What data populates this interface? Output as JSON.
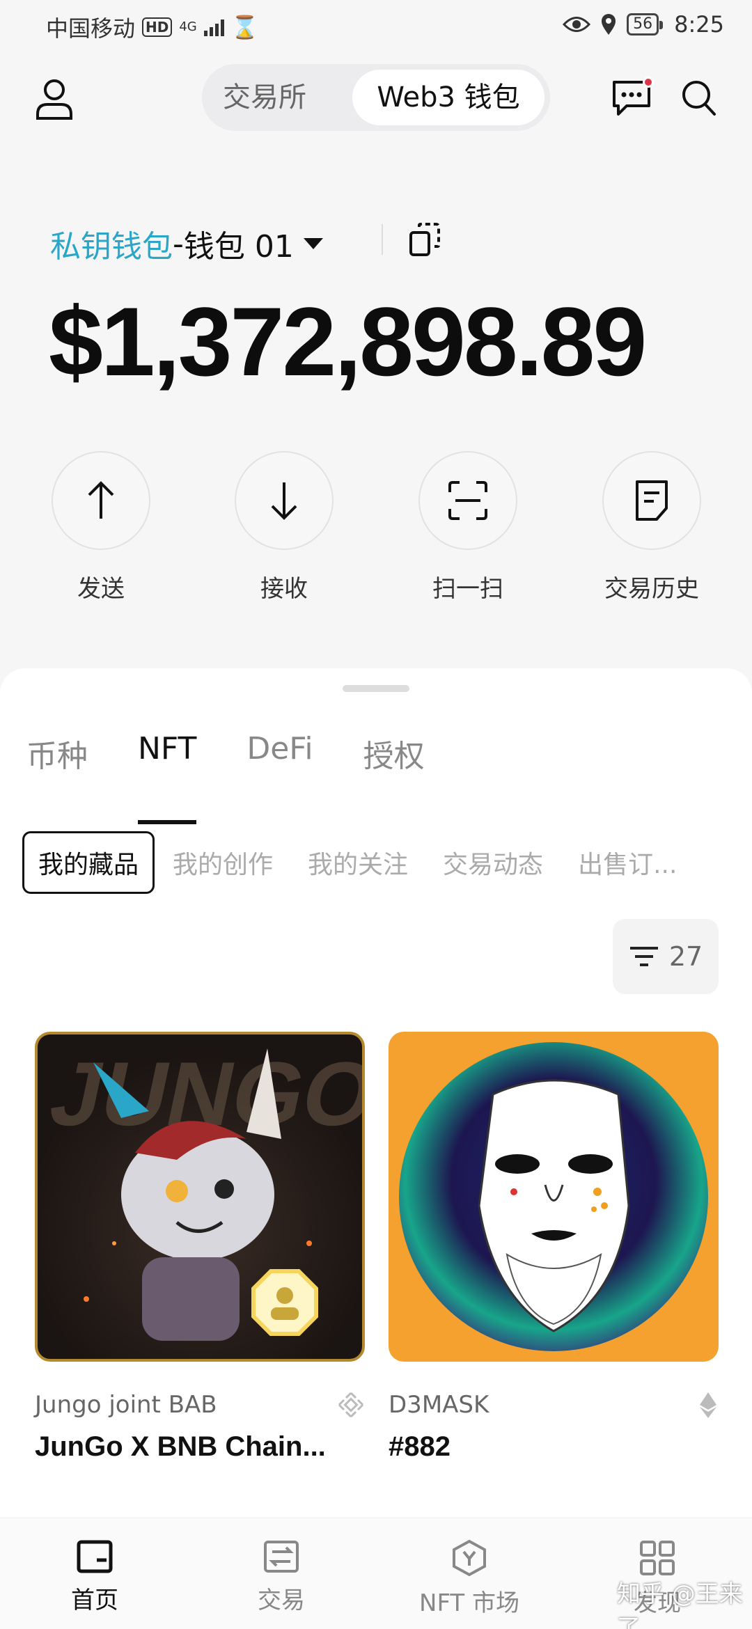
{
  "status_bar": {
    "carrier": "中国移动",
    "hd": "HD",
    "network": "4G",
    "battery": "56",
    "time": "8:25"
  },
  "header": {
    "segment": [
      "交易所",
      "Web3 钱包"
    ],
    "active_segment": "Web3 钱包"
  },
  "wallet": {
    "type_label": "私钥钱包",
    "separator": " - ",
    "name": "钱包 01",
    "balance": "$1,372,898.89"
  },
  "actions": [
    {
      "label": "发送",
      "icon": "arrow-up-icon"
    },
    {
      "label": "接收",
      "icon": "arrow-down-icon"
    },
    {
      "label": "扫一扫",
      "icon": "scan-icon"
    },
    {
      "label": "交易历史",
      "icon": "history-icon"
    }
  ],
  "tabs": [
    "币种",
    "NFT",
    "DeFi",
    "授权"
  ],
  "active_tab": "NFT",
  "subtabs": [
    "我的藏品",
    "我的创作",
    "我的关注",
    "交易动态",
    "出售订..."
  ],
  "filter": {
    "count": "27",
    "icon": "filter-icon"
  },
  "nfts": [
    {
      "collection": "Jungo joint BAB",
      "title": "JunGo X BNB Chain...",
      "chain_icon": "bnb-icon"
    },
    {
      "collection": "D3MASK",
      "title": "#882",
      "chain_icon": "eth-icon"
    }
  ],
  "bottom_nav": [
    {
      "label": "首页",
      "icon": "wallet-icon"
    },
    {
      "label": "交易",
      "icon": "swap-icon"
    },
    {
      "label": "NFT 市场",
      "icon": "nft-market-icon"
    },
    {
      "label": "发现",
      "icon": "grid-icon"
    }
  ],
  "watermark": "知乎 @王来了",
  "colors": {
    "accent": "#2aa7c8",
    "notify": "#e0334a",
    "nft2_bg": "#f5a12f"
  }
}
